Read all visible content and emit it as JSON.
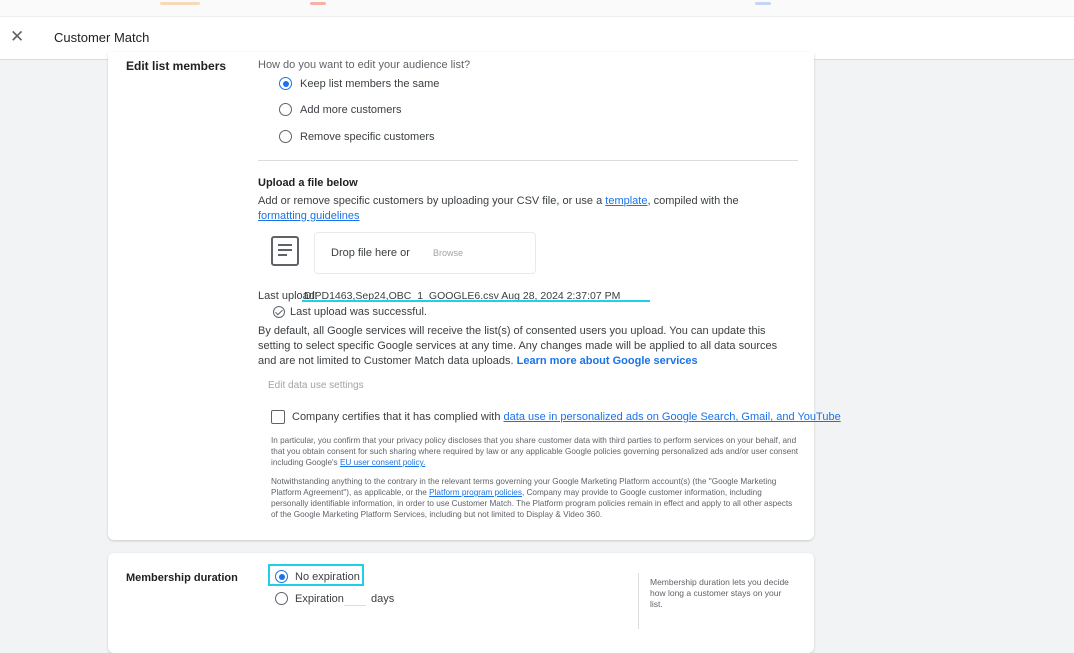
{
  "app": {
    "title": "Customer Match"
  },
  "edit_members": {
    "label": "Edit list members",
    "question": "How do you want to edit your audience list?",
    "options": [
      {
        "label": "Keep list members the same",
        "selected": true
      },
      {
        "label": "Add more customers",
        "selected": false
      },
      {
        "label": "Remove specific customers",
        "selected": false
      }
    ]
  },
  "upload": {
    "heading": "Upload a file below",
    "desc_before": "Add or remove specific customers by uploading your CSV file, or use a",
    "template_link": "template",
    "desc_mid": ", compiled with the",
    "formatting_link": "formatting guidelines",
    "drop_text": "Drop file here or",
    "browse": "Browse",
    "last_upload_label": "Last upload:",
    "last_upload_value": "DIPD1463,Sep24,OBC_1_GOOGLE6.csv  Aug 28, 2024 2:37:07 PM",
    "success": "Last upload was successful."
  },
  "data_use": {
    "text": "By default, all Google services will receive the list(s) of consented users you upload. You can update this setting to select specific Google services at any time. Any changes made will be applied to all data sources and are not limited to Customer Match data uploads.",
    "learn_more": "Learn more about Google services",
    "edit_settings": "Edit data use settings"
  },
  "certify": {
    "text": "Company certifies that it has complied with",
    "link": "data use in personalized ads on Google Search, Gmail, and YouTube",
    "para1": "In particular, you confirm that your privacy policy discloses that you share customer data with third parties to perform services on your behalf, and that you obtain consent for such sharing where required by law or any applicable Google policies governing personalized ads and/or user consent including Google's",
    "para1_link": "EU user consent policy.",
    "para2_a": "Notwithstanding anything to the contrary in the relevant terms governing your Google Marketing Platform account(s) (the \"Google Marketing Platform Agreement\"), as applicable, or the",
    "para2_link": "Platform program policies",
    "para2_b": ", Company may provide to Google customer information, including personally identifiable information, in order to use Customer Match. The Platform program policies remain in effect and apply to all other aspects of the Google Marketing Platform Services, including but not limited to Display & Video 360."
  },
  "membership": {
    "label": "Membership duration",
    "options": [
      {
        "label": "No expiration",
        "selected": true
      },
      {
        "label": "Expiration",
        "selected": false
      }
    ],
    "days": "days",
    "help": "Membership duration lets you decide how long a customer stays on your list."
  },
  "colors": {
    "accent": "#1a73e8",
    "highlight": "#1fd0e6"
  }
}
